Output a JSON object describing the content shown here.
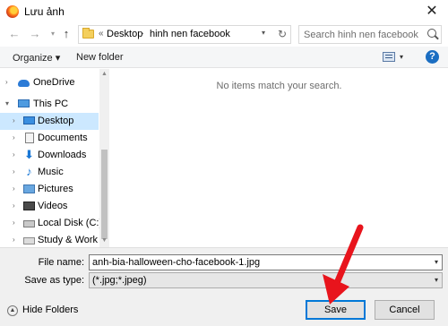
{
  "window": {
    "title": "Lưu ảnh",
    "close_glyph": "✕"
  },
  "nav": {
    "address": {
      "overflow": "«",
      "crumbs": [
        "Desktop",
        "hinh nen facebook"
      ]
    },
    "search": {
      "placeholder": "Search hinh nen facebook"
    }
  },
  "toolbar": {
    "organize_label": "Organize ▾",
    "new_folder_label": "New folder",
    "help": "?"
  },
  "sidebar": {
    "items": [
      {
        "label": "OneDrive"
      },
      {
        "label": "This PC"
      },
      {
        "label": "Desktop"
      },
      {
        "label": "Documents"
      },
      {
        "label": "Downloads"
      },
      {
        "label": "Music"
      },
      {
        "label": "Pictures"
      },
      {
        "label": "Videos"
      },
      {
        "label": "Local Disk (C:)"
      },
      {
        "label": "Study & Work (E"
      }
    ],
    "selected": "Desktop"
  },
  "content": {
    "empty_message": "No items match your search."
  },
  "form": {
    "file_name_label": "File name:",
    "file_name_value": "anh-bia-halloween-cho-facebook-1.jpg",
    "save_type_label": "Save as type:",
    "save_type_value": "(*.jpg;*.jpeg)"
  },
  "footer": {
    "hide_folders_label": "Hide Folders",
    "save_label": "Save",
    "cancel_label": "Cancel"
  },
  "colors": {
    "selection": "#cce8ff",
    "accent": "#0078d7",
    "arrow": "#e8141c"
  }
}
